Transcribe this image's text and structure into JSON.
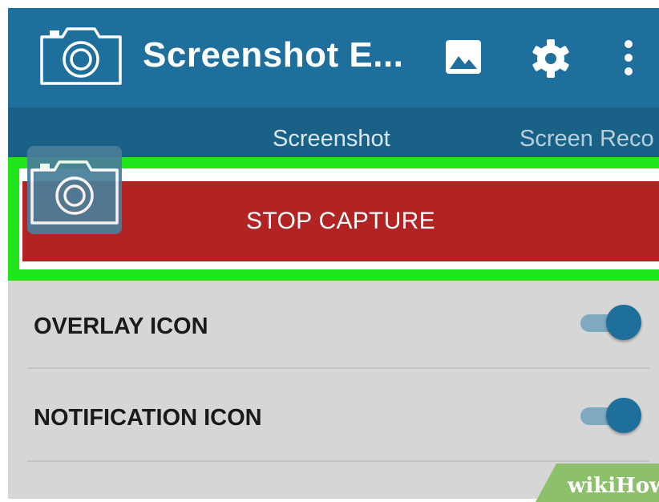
{
  "app": {
    "title": "Screenshot E...",
    "colors": {
      "toolbar": "#1e6f9b",
      "tabs": "#1a6188",
      "capture": "#b22424",
      "highlight": "#22e61c",
      "background": "#d6d6d6"
    }
  },
  "toolbar": {
    "icons": [
      "camera-icon",
      "image-icon",
      "gear-icon",
      "overflow-menu-icon"
    ]
  },
  "tabs": [
    {
      "label": "Screenshot",
      "active": true
    },
    {
      "label": "Screen Reco",
      "active": false
    }
  ],
  "capture": {
    "label": "STOP CAPTURE"
  },
  "settings": [
    {
      "label": "OVERLAY ICON",
      "enabled": true
    },
    {
      "label": "NOTIFICATION ICON",
      "enabled": true
    }
  ],
  "watermark": {
    "text": "wikiHow"
  }
}
